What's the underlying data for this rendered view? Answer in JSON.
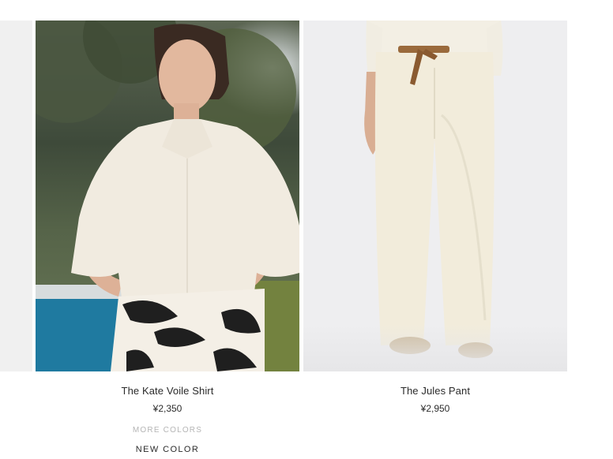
{
  "products": [
    {
      "name": "The Kate Voile Shirt",
      "price": "¥2,350",
      "more_colors": "MORE COLORS",
      "badge": "NEW COLOR",
      "image_alt": "Model wearing cream voile shirt with palm-print sarong by a pool"
    },
    {
      "name": "The Jules Pant",
      "price": "¥2,950",
      "image_alt": "Model wearing cream wide-leg pants with brown belt"
    }
  ],
  "colors": {
    "text": "#2b2b2b",
    "muted": "#b5b5b5",
    "page": "#ffffff"
  }
}
